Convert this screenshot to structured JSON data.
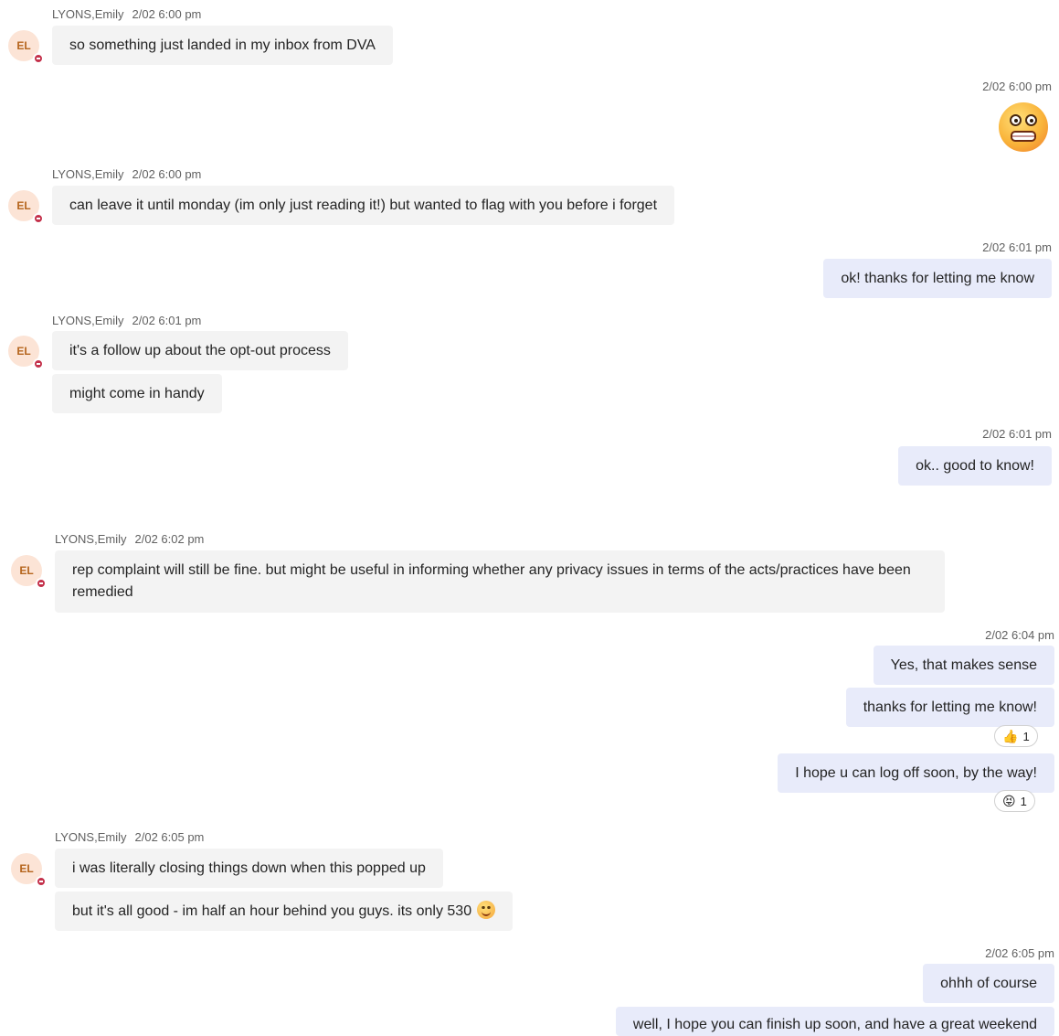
{
  "sender": {
    "name": "LYONS,Emily",
    "initials": "EL",
    "presence": "do-not-disturb",
    "presence_color": "#c4314b"
  },
  "messages": [
    {
      "direction": "in",
      "time": "2/02 6:00 pm",
      "bubbles": [
        "so something just landed in my inbox from DVA"
      ]
    },
    {
      "direction": "out",
      "time": "2/02 6:00 pm",
      "emoji": "grimacing-face-emoji"
    },
    {
      "direction": "in",
      "time": "2/02 6:00 pm",
      "bubbles": [
        "can leave it until monday (im only just reading it!) but wanted to flag with you before i forget"
      ]
    },
    {
      "direction": "out",
      "time": "2/02 6:01 pm",
      "bubbles": [
        "ok! thanks for letting me know"
      ]
    },
    {
      "direction": "in",
      "time": "2/02 6:01 pm",
      "bubbles": [
        "it's a follow up about the opt-out process",
        "might come in handy"
      ]
    },
    {
      "direction": "out",
      "time": "2/02 6:01 pm",
      "bubbles": [
        "ok.. good to know!"
      ]
    },
    {
      "direction": "in",
      "time": "2/02 6:02 pm",
      "bubbles": [
        "rep complaint will still be fine. but might be useful in informing whether any privacy issues in terms of the acts/practices have been remedied"
      ]
    },
    {
      "direction": "out",
      "time": "2/02 6:04 pm",
      "bubbles": [
        "Yes, that makes sense",
        "thanks for letting me know!",
        "I hope u can log off soon, by the way!"
      ],
      "reactions": [
        {
          "icon": "thumbs-up-icon",
          "count": "1"
        },
        {
          "icon": "laughing-face-icon",
          "count": "1"
        }
      ]
    },
    {
      "direction": "in",
      "time": "2/02 6:05 pm",
      "bubbles": [
        "i was literally closing things down when this popped up",
        "but it's all good - im half an hour behind you guys. its only 530"
      ]
    },
    {
      "direction": "out",
      "time": "2/02 6:05 pm",
      "bubbles": [
        "ohhh of course",
        "well, I hope you can finish up soon, and have a great weekend"
      ]
    }
  ],
  "colors": {
    "incoming_bubble": "#f3f3f3",
    "outgoing_bubble": "#e8ebfa",
    "avatar_bg": "#fce4d6"
  }
}
